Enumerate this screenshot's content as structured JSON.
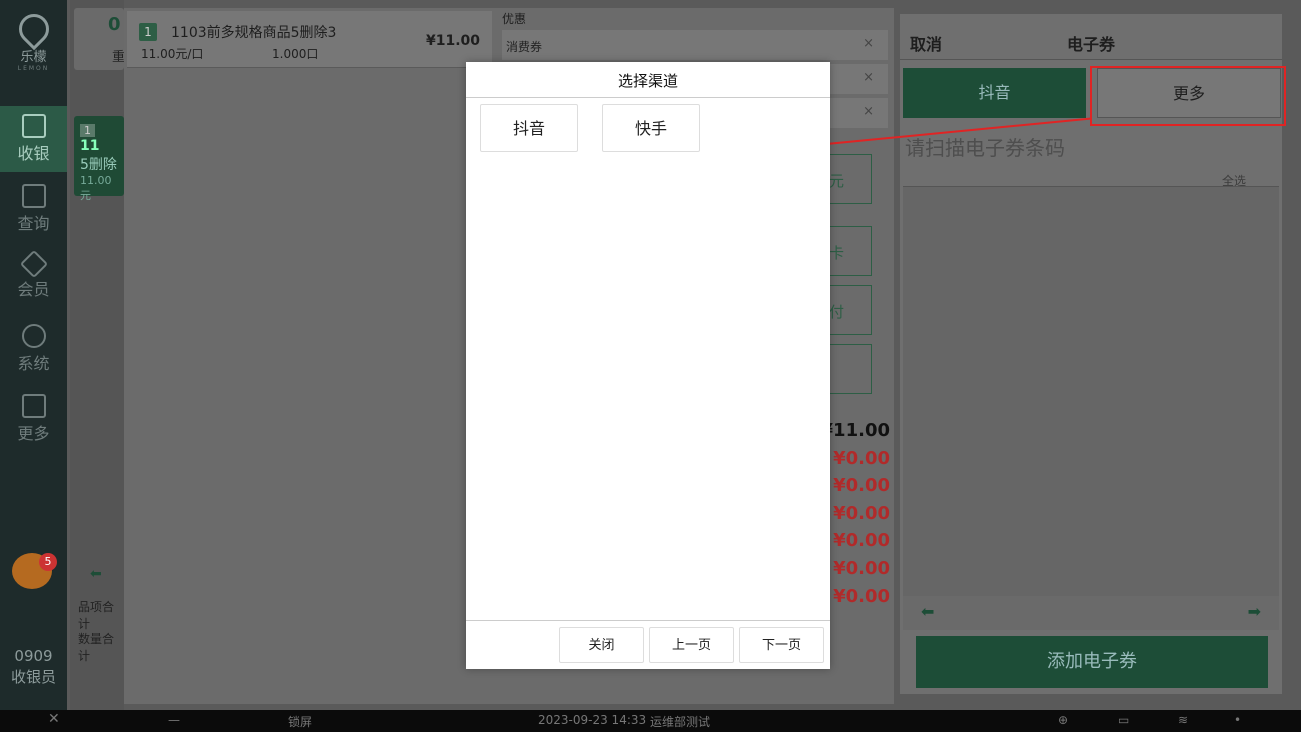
{
  "sidebar": {
    "logo_text": "乐檬",
    "logo_sub": "LEMON",
    "items": [
      {
        "label": "收银"
      },
      {
        "label": "查询"
      },
      {
        "label": "会员"
      },
      {
        "label": "系统"
      },
      {
        "label": "更多"
      }
    ],
    "notification_count": "5",
    "user_id": "0909",
    "user_role": "收银员"
  },
  "left_strip": {
    "count_digit": "0",
    "count_suffix": "重",
    "item_num": "1",
    "item_snippet": "11",
    "item_name_part": "5删除",
    "item_price_part": "11.00元",
    "summary_items": "品项合计",
    "summary_qty": "数量合计"
  },
  "order": {
    "items": [
      {
        "num": "1",
        "name": "1103前多规格商品5删除3",
        "price": "¥11.00",
        "unit_price": "11.00元/口",
        "qty": "1.000口"
      }
    ]
  },
  "discount": {
    "title": "优惠",
    "coupon_label": "消费券",
    "close_glyph": "×",
    "partial_labels": [
      "元",
      "卡",
      "付"
    ],
    "total": "¥11.00",
    "amounts": [
      "¥0.00",
      "¥0.00",
      "¥0.00",
      "¥0.00",
      "¥0.00",
      "¥0.00"
    ]
  },
  "ecoupon": {
    "cancel": "取消",
    "title": "电子券",
    "tab_douyin": "抖音",
    "tab_more": "更多",
    "scan_placeholder": "请扫描电子券条码",
    "select_all": "全选",
    "add_button": "添加电子券"
  },
  "modal": {
    "title": "选择渠道",
    "channels": [
      "抖音",
      "快手"
    ],
    "close": "关闭",
    "prev": "上一页",
    "next": "下一页"
  },
  "taskbar": {
    "lock": "锁屏",
    "datetime": "2023-09-23 14:33",
    "store": "运维部测试"
  },
  "colors": {
    "accent_green": "#2d6e50",
    "annotation_red": "#e02424",
    "amount_red": "#b12a2a"
  }
}
